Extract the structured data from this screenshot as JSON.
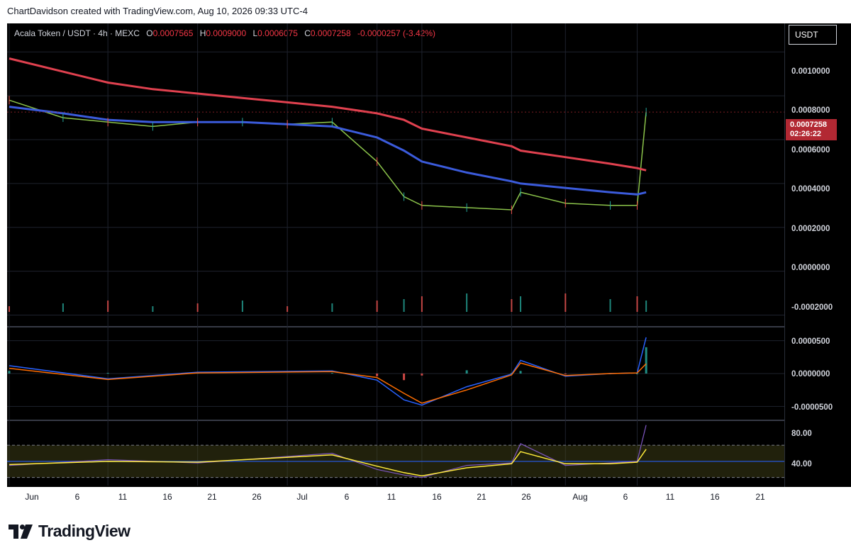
{
  "credit": "ChartDavidson created with TradingView.com, Aug 10, 2026 09:33 UTC-4",
  "symbol": {
    "name": "Acala Token / USDT · 4h · MEXC",
    "o_label": "O",
    "o": "0.0007565",
    "h_label": "H",
    "h": "0.0009000",
    "l_label": "L",
    "l": "0.0006075",
    "c_label": "C",
    "c": "0.0007258",
    "change": "-0.0000257 (-3.42%)"
  },
  "currency_badge": "USDT",
  "price_tag": {
    "price": "0.0007258",
    "countdown": "02:26:22"
  },
  "price_axis_labels": [
    "0.0010000",
    "0.0008000",
    "0.0006000",
    "0.0004000",
    "0.0002000",
    "0.0000000",
    "-0.0002000"
  ],
  "macd_axis_labels": [
    "0.0000500",
    "0.0000000",
    "-0.0000500"
  ],
  "rsi_axis_labels": [
    "80.00",
    "40.00"
  ],
  "date_labels": [
    "Jun",
    "6",
    "11",
    "16",
    "21",
    "26",
    "Jul",
    "6",
    "11",
    "16",
    "21",
    "26",
    "Aug",
    "6",
    "11",
    "16",
    "21"
  ],
  "brand": "TradingView",
  "colors": {
    "background": "#000000",
    "ema_long": "#e0414f",
    "ema_mid": "#3b5bdb",
    "ema_short_green": "#8bc34a",
    "ema_short_orange": "#f5a623",
    "candle_up": "#26a69a",
    "candle_down": "#ef5350",
    "macd_line": "#2962ff",
    "signal_line": "#ff6d00",
    "rsi_line": "#7e57c2",
    "rsi_ma": "#ffeb3b",
    "price_tag": "#b22833"
  },
  "chart_data": {
    "type": "line",
    "title": "Acala Token / USDT · 4h · MEXC",
    "x": [
      "May 31",
      "Jun 6",
      "Jun 11",
      "Jun 16",
      "Jun 21",
      "Jun 26",
      "Jul 1",
      "Jul 6",
      "Jul 11",
      "Jul 14",
      "Jul 16",
      "Jul 21",
      "Jul 26",
      "Jul 27",
      "Aug 1",
      "Aug 6",
      "Aug 9",
      "Aug 10"
    ],
    "series": [
      {
        "values": [
          0.00078,
          0.0007,
          0.00068,
          0.00066,
          0.00068,
          0.00068,
          0.00067,
          0.00068,
          0.0005,
          0.00034,
          0.0003,
          0.00029,
          0.00028,
          0.00036,
          0.00031,
          0.0003,
          0.0003,
          0.0007258
        ]
      },
      {
        "values": [
          0.00075,
          0.00072,
          0.00069,
          0.00068,
          0.00068,
          0.00068,
          0.00067,
          0.00066,
          0.00061,
          0.00055,
          0.0005,
          0.00045,
          0.00041,
          0.0004,
          0.00038,
          0.00036,
          0.00035,
          0.00036
        ]
      },
      {
        "values": [
          0.00097,
          0.00091,
          0.00086,
          0.00083,
          0.00081,
          0.00079,
          0.00077,
          0.00075,
          0.00072,
          0.00069,
          0.00065,
          0.00061,
          0.00057,
          0.00055,
          0.00052,
          0.00049,
          0.00047,
          0.00046
        ]
      }
    ],
    "ylim": [
      -0.00025,
      0.00113
    ],
    "macd": {
      "x": [
        "May 31",
        "Jun 11",
        "Jun 21",
        "Jul 6",
        "Jul 11",
        "Jul 14",
        "Jul 16",
        "Jul 21",
        "Jul 26",
        "Jul 27",
        "Aug 1",
        "Aug 6",
        "Aug 9",
        "Aug 10"
      ],
      "macd": [
        1.2e-05,
        -8e-06,
        2e-06,
        4e-06,
        -1e-05,
        -4e-05,
        -4.8e-05,
        -2e-05,
        -1e-06,
        2e-05,
        -4e-06,
        0.0,
        1e-06,
        5.5e-05
      ],
      "signal": [
        8e-06,
        -9e-06,
        1e-06,
        3e-06,
        -6e-06,
        -3e-05,
        -4.5e-05,
        -2.5e-05,
        -2e-06,
        1.6e-05,
        -3e-06,
        0.0,
        1e-06,
        1.5e-05
      ],
      "ylim": [
        -7e-05,
        7e-05
      ]
    },
    "rsi": {
      "x": [
        "May 31",
        "Jun 11",
        "Jun 21",
        "Jul 6",
        "Jul 11",
        "Jul 14",
        "Jul 16",
        "Jul 21",
        "Jul 26",
        "Jul 27",
        "Aug 1",
        "Aug 6",
        "Aug 9",
        "Aug 10"
      ],
      "rsi": [
        45,
        52,
        48,
        60,
        40,
        33,
        30,
        45,
        48,
        72,
        45,
        48,
        50,
        95
      ],
      "rsi_ma": [
        46,
        50,
        49,
        58,
        44,
        36,
        32,
        42,
        47,
        62,
        47,
        47,
        49,
        65
      ],
      "ylim": [
        20,
        100
      ],
      "bands": [
        70,
        30
      ]
    }
  }
}
